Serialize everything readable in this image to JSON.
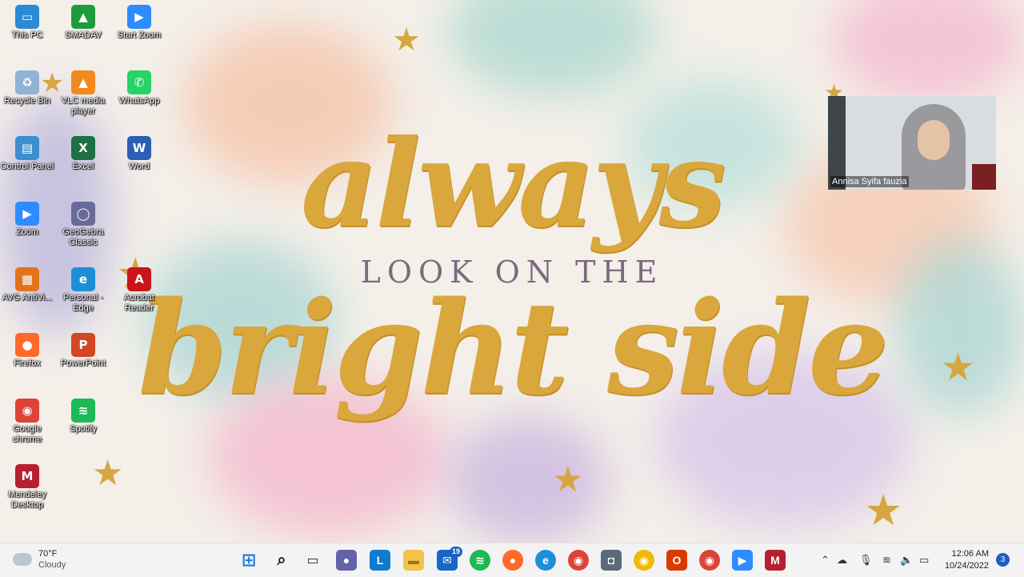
{
  "wallpaper": {
    "line1": "always",
    "line2": "LOOK ON THE",
    "line3": "bright side"
  },
  "desktop_icons": [
    {
      "label": "This PC",
      "icon": "monitor-icon",
      "color": "#2a8ad6",
      "glyph": "▭"
    },
    {
      "label": "SMADAV",
      "icon": "smadav-icon",
      "color": "#1e9b3a",
      "glyph": "▲"
    },
    {
      "label": "Start Zoom",
      "icon": "zoom-icon",
      "color": "#2d8cff",
      "glyph": "▶"
    },
    {
      "label": "Recycle Bin",
      "icon": "recycle-bin-icon",
      "color": "#8fb4d6",
      "glyph": "♻"
    },
    {
      "label": "VLC media player",
      "icon": "vlc-icon",
      "color": "#f08a1c",
      "glyph": "▲"
    },
    {
      "label": "WhatsApp",
      "icon": "whatsapp-icon",
      "color": "#25d366",
      "glyph": "✆"
    },
    {
      "label": "Control Panel",
      "icon": "control-panel-icon",
      "color": "#3b8fd0",
      "glyph": "▤"
    },
    {
      "label": "Excel",
      "icon": "excel-icon",
      "color": "#1d7044",
      "glyph": "X"
    },
    {
      "label": "Word",
      "icon": "word-icon",
      "color": "#2b5fb3",
      "glyph": "W"
    },
    {
      "label": "Zoom",
      "icon": "zoom-icon",
      "color": "#2d8cff",
      "glyph": "▶"
    },
    {
      "label": "GeoGebra Classic",
      "icon": "geogebra-icon",
      "color": "#6a6a9a",
      "glyph": "◯"
    },
    {
      "label": "AVG AntiVi...",
      "icon": "avg-icon",
      "color": "#e2731a",
      "glyph": "▦"
    },
    {
      "label": "Personal - Edge",
      "icon": "edge-icon",
      "color": "#1d8fd6",
      "glyph": "e"
    },
    {
      "label": "Acrobat Reader",
      "icon": "acrobat-icon",
      "color": "#c8141a",
      "glyph": "A"
    },
    {
      "label": "Firefox",
      "icon": "firefox-icon",
      "color": "#ff6a2b",
      "glyph": "●"
    },
    {
      "label": "PowerPoint",
      "icon": "powerpoint-icon",
      "color": "#d24726",
      "glyph": "P"
    },
    {
      "label": "Google chrome",
      "icon": "chrome-icon",
      "color": "#db4437",
      "glyph": "◉"
    },
    {
      "label": "Spotify",
      "icon": "spotify-icon",
      "color": "#1db954",
      "glyph": "≋"
    },
    {
      "label": "Mendeley Desktop",
      "icon": "mendeley-icon",
      "color": "#b51f2e",
      "glyph": "M"
    }
  ],
  "video": {
    "participant_name": "Annisa Syifa fauzia"
  },
  "taskbar": {
    "weather_temp": "70°F",
    "weather_desc": "Cloudy",
    "mail_badge": "19",
    "time": "12:06 AM",
    "date": "10/24/2022",
    "notification_count": "3"
  }
}
